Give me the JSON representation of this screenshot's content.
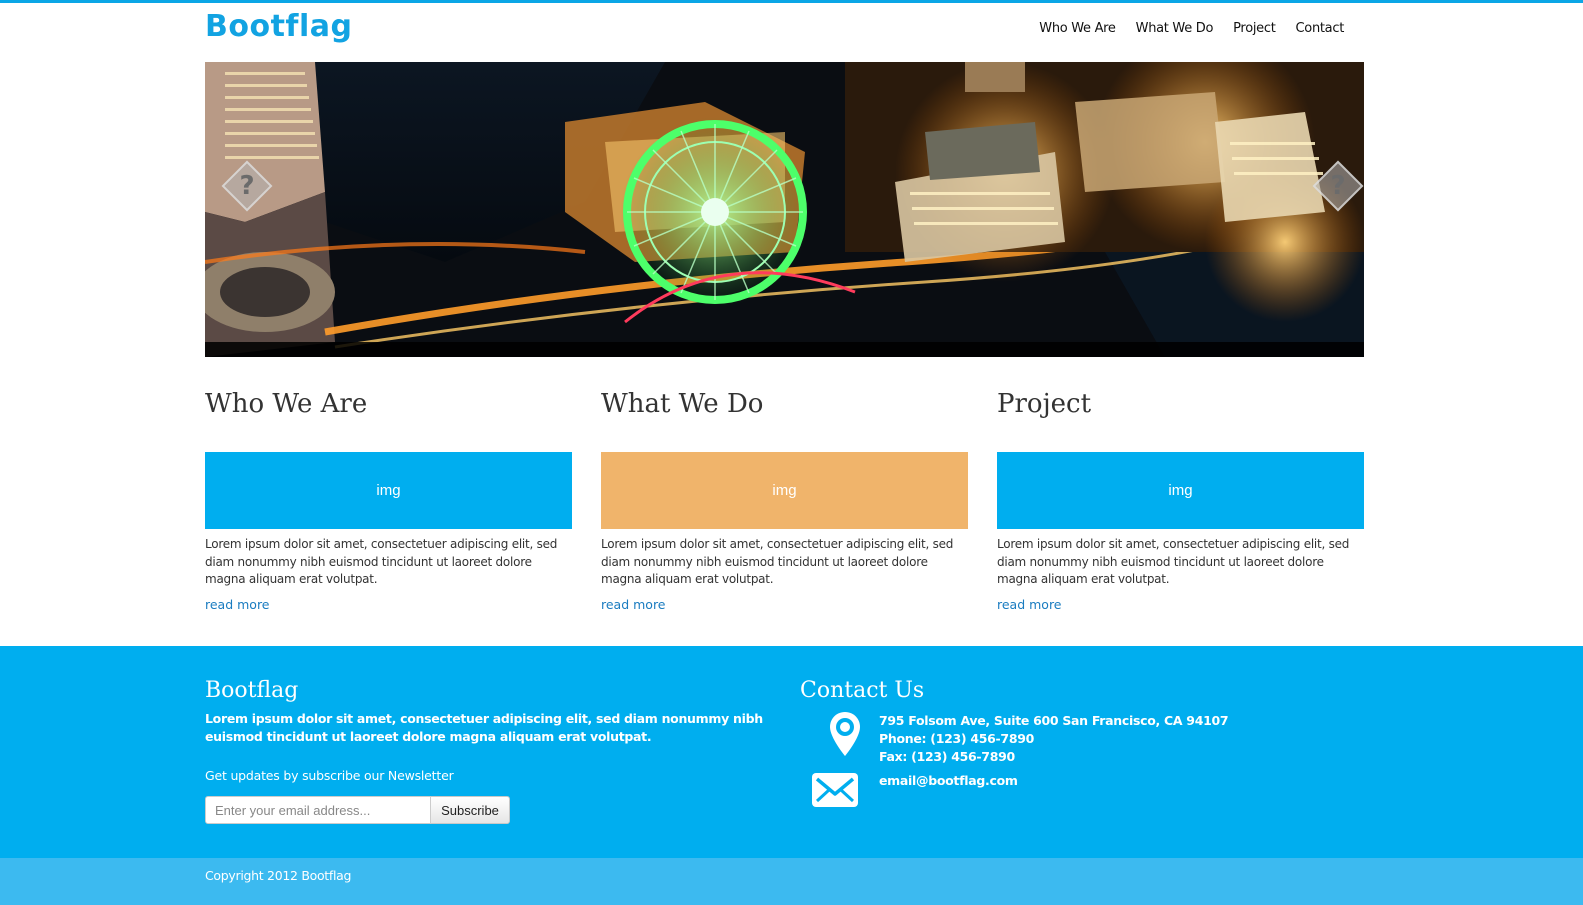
{
  "header": {
    "brand": "Bootflag",
    "nav": [
      "Who We Are",
      "What We Do",
      "Project",
      "Contact"
    ]
  },
  "hero": {
    "left_arrow_icon": "chevron-left-icon",
    "right_arrow_icon": "chevron-right-icon",
    "arrow_glyph": "?"
  },
  "columns": [
    {
      "title": "Who We Are",
      "img_label": "img",
      "img_color": "#00aeef",
      "text": "Lorem ipsum dolor sit amet, consectetuer adipiscing elit, sed diam nonummy nibh euismod tincidunt ut laoreet dolore magna aliquam erat volutpat.",
      "link": "read more"
    },
    {
      "title": "What We Do",
      "img_label": "img",
      "img_color": "#f0b46b",
      "text": "Lorem ipsum dolor sit amet, consectetuer adipiscing elit, sed diam nonummy nibh euismod tincidunt ut laoreet dolore magna aliquam erat volutpat.",
      "link": "read more"
    },
    {
      "title": "Project",
      "img_label": "img",
      "img_color": "#00aeef",
      "text": "Lorem ipsum dolor sit amet, consectetuer adipiscing elit, sed diam nonummy nibh euismod tincidunt ut laoreet dolore magna aliquam erat volutpat.",
      "link": "read more"
    }
  ],
  "footer": {
    "brand": "Bootflag",
    "description": "Lorem ipsum dolor sit amet, consectetuer adipiscing elit, sed diam nonummy nibh euismod tincidunt ut laoreet dolore magna aliquam erat volutpat.",
    "newsletter_label": "Get updates by subscribe our Newsletter",
    "email_placeholder": "Enter your email address...",
    "subscribe_label": "Subscribe",
    "contact_title": "Contact Us",
    "address": "795 Folsom Ave, Suite 600 San Francisco, CA 94107",
    "phone": "Phone: (123) 456-7890",
    "fax": "Fax: (123) 456-7890",
    "email": "email@bootflag.com",
    "location_icon": "map-pin-icon",
    "mail_icon": "envelope-icon"
  },
  "copyright": "Copyright 2012 Bootflag",
  "colors": {
    "accent": "#00aeef",
    "top_bar": "#0ba6e6",
    "copyright_bar": "#3cbaf0",
    "link": "#1a7cc0"
  }
}
